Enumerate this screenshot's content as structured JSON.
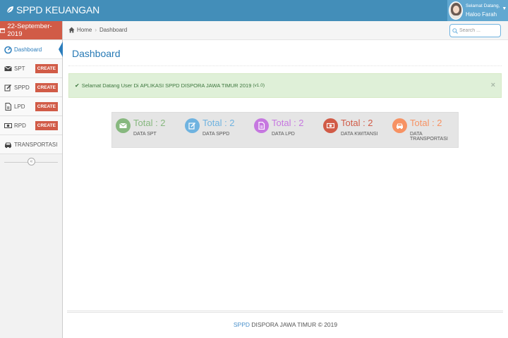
{
  "navbar": {
    "brand": "SPPD KEUANGAN",
    "user_greeting": "Selamat Datang,",
    "user_name": "Haloo Farah"
  },
  "sidebar": {
    "date": "22-September-2019",
    "items": [
      {
        "label": "Dashboard",
        "icon": "dashboard-icon",
        "active": true
      },
      {
        "label": "SPT",
        "icon": "envelope-icon",
        "badge": "CREATE"
      },
      {
        "label": "SPPD",
        "icon": "edit-icon",
        "badge": "CREATE"
      },
      {
        "label": "LPD",
        "icon": "file-icon",
        "badge": "CREATE"
      },
      {
        "label": "RPD",
        "icon": "money-icon",
        "badge": "CREATE"
      },
      {
        "label": "TRANSPORTASI",
        "icon": "car-icon"
      }
    ]
  },
  "breadcrumbs": {
    "home": "Home",
    "current": "Dashboard"
  },
  "search": {
    "placeholder": "Search ..."
  },
  "page": {
    "title": "Dashboard"
  },
  "alert": {
    "prefix": "Selamat Datang User Di",
    "app_name": "APLIKASI SPPD DISPORA JAWA TIMUR 2019",
    "version": "(v1.0)",
    "close": "×"
  },
  "stats": [
    {
      "total": "Total : 2",
      "label": "DATA SPT",
      "color": "#87b87f",
      "icon": "envelope-icon"
    },
    {
      "total": "Total : 2",
      "label": "DATA SPPD",
      "color": "#6fb3e0",
      "icon": "edit-icon"
    },
    {
      "total": "Total : 2",
      "label": "DATA LPD",
      "color": "#c678e0",
      "icon": "file-icon"
    },
    {
      "total": "Total : 2",
      "label": "DATA KWITANSI",
      "color": "#d15b47",
      "icon": "money-icon"
    },
    {
      "total": "Total : 2",
      "label": "DATA TRANSPORTASI",
      "color": "#f79263",
      "icon": "car-icon"
    }
  ],
  "footer": {
    "brand": "SPPD",
    "text": "DISPORA JAWA TIMUR © 2019"
  },
  "colors": {
    "navbar": "#438eb9",
    "date_box": "#d15b47",
    "badge": "#d15b47",
    "link": "#2679b5"
  }
}
